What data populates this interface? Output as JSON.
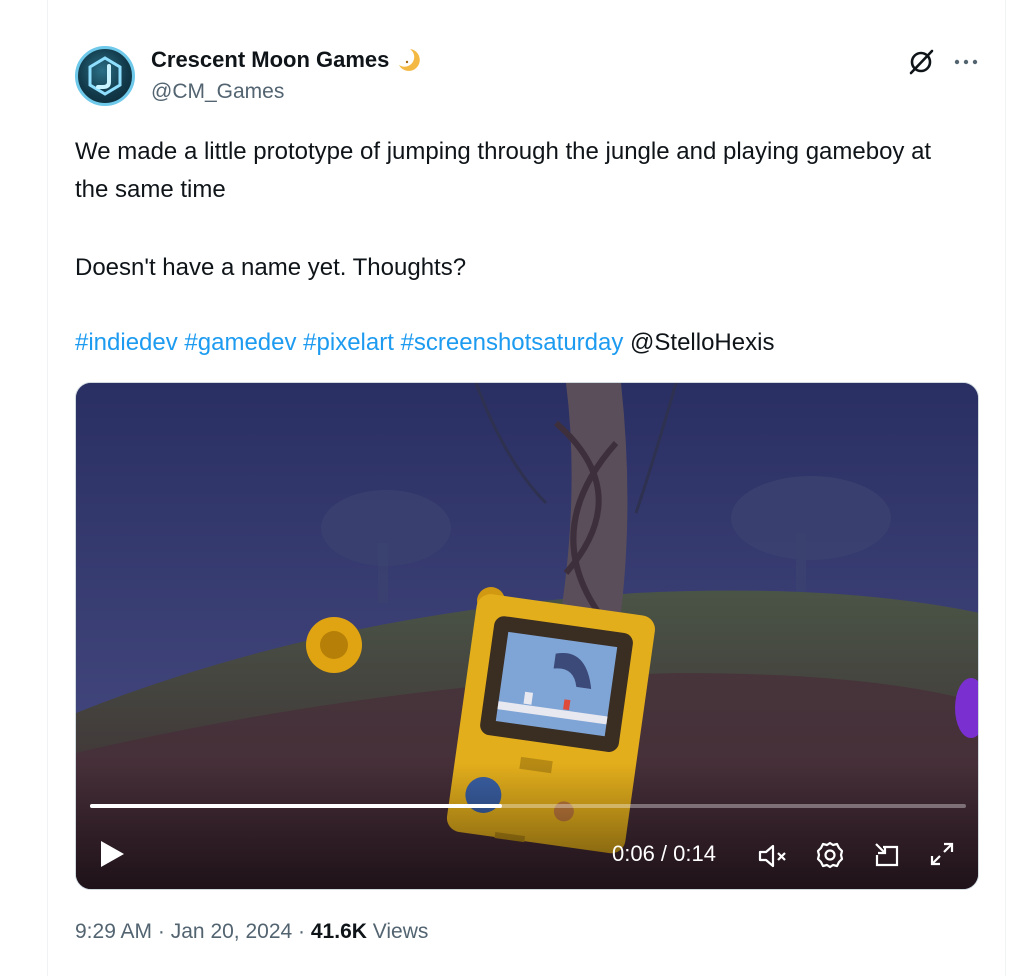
{
  "author": {
    "display_name": "Crescent Moon Games",
    "handle": "@CM_Games"
  },
  "tweet": {
    "line1": "We made a little prototype of jumping through the jungle and playing gameboy at the same time",
    "line2": "Doesn't have a name yet. Thoughts?",
    "hashtags": [
      "#indiedev",
      "#gamedev",
      "#pixelart",
      "#screenshotsaturday"
    ],
    "mention": "@StelloHexis"
  },
  "video": {
    "time_display": "0:06 / 0:14",
    "progress": 0.47,
    "muted": true
  },
  "meta": {
    "time": "9:29 AM",
    "date": "Jan 20, 2024",
    "views_count": "41.6K",
    "views_label": "Views",
    "separator": "·"
  },
  "icons": {
    "grok": "grok-icon",
    "more": "more-icon",
    "play": "play-icon",
    "mute": "mute-icon",
    "settings": "settings-icon",
    "pip": "pip-icon",
    "fullscreen": "fullscreen-icon"
  },
  "colors": {
    "link": "#1d9bf0",
    "secondary_text": "#536471",
    "primary_text": "#0f1419"
  }
}
